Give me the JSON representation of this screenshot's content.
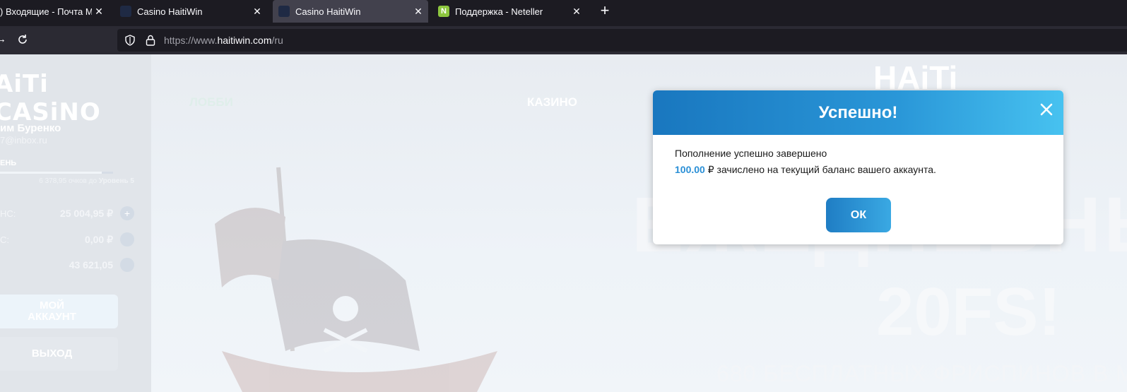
{
  "browser": {
    "tabs": [
      {
        "title": ") Входящие - Почта Mail.ru",
        "favicon_color": "#1c1b22"
      },
      {
        "title": "Casino HaitiWin",
        "favicon_color": "#1f2a44"
      },
      {
        "title": "Casino HaitiWin",
        "favicon_color": "#1f2a44",
        "active": true
      },
      {
        "title": "Поддержка - Neteller",
        "favicon_color": "#8dc63f"
      }
    ],
    "new_tab_label": "+",
    "close_glyph": "✕",
    "url_prefix": "https://www.",
    "url_domain": "haitiwin.com",
    "url_suffix": "/ru"
  },
  "sidebar": {
    "logo": "AiTi CASiNO",
    "username": "им Буренко",
    "email": "7@inbox.ru",
    "level_label": "ЕНЬ",
    "level_progress_fraction": 0.9,
    "points_text": "6 378,95 очков до",
    "points_next": "Уровень 5",
    "balances": [
      {
        "label": "НС:",
        "value": "25 004,95 ₽",
        "icon": "+"
      },
      {
        "label": "С:",
        "value": "0,00 ₽",
        "icon": ""
      },
      {
        "label": "",
        "value": "43 621,05",
        "icon": ""
      }
    ],
    "account_button": "МОЙ АККАУНТ",
    "exit_button": "ВЫХОД"
  },
  "main": {
    "nav_lobby": "ЛОББИ",
    "nav_casino": "КАЗИНО",
    "hero_logo": "HAiTi",
    "hero_big": "ЕЖЕДНЕВНЫЙ Б",
    "hero_fs": "20FS!",
    "hero_sub": "680 БЕСПЛАТНЫХ ФРИСПИНОВ В М"
  },
  "modal": {
    "title": "Успешно!",
    "line1": "Пополнение успешно завершено",
    "amount": "100.00",
    "currency": "₽",
    "line2_rest": " зачислено на текущий баланс вашего аккаунта.",
    "ok_button": "ОК"
  },
  "colors": {
    "modal_header_start": "#1977bf",
    "modal_header_end": "#47c2f0",
    "amount_color": "#2a8fd6",
    "browser_bg": "#1c1b22"
  }
}
